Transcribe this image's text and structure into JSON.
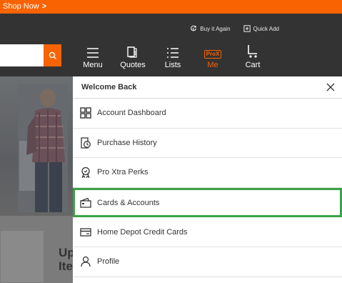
{
  "promo": {
    "text": "Shop Now",
    "chevron": ">"
  },
  "header": {
    "utility": [
      {
        "label": "Buy it Again",
        "icon": "refresh-dollar-icon"
      },
      {
        "label": "Quick Add",
        "icon": "quick-add-icon"
      }
    ],
    "nav": [
      {
        "label": "Menu",
        "icon": "hamburger-icon"
      },
      {
        "label": "Quotes",
        "icon": "quotes-icon"
      },
      {
        "label": "Lists",
        "icon": "lists-icon"
      },
      {
        "label": "Me",
        "icon": "prox-icon",
        "badge": "ProX"
      },
      {
        "label": "Cart",
        "icon": "cart-icon"
      }
    ]
  },
  "background": {
    "heading_line1": "Up",
    "heading_line2": "Ite"
  },
  "panel": {
    "title": "Welcome Back",
    "items": [
      {
        "label": "Account Dashboard",
        "icon": "dashboard-grid-icon"
      },
      {
        "label": "Purchase History",
        "icon": "purchase-history-icon"
      },
      {
        "label": "Pro Xtra Perks",
        "icon": "perks-badge-icon"
      },
      {
        "label": "Cards & Accounts",
        "icon": "wallet-icon"
      },
      {
        "label": "Home Depot Credit Cards",
        "icon": "credit-card-icon"
      },
      {
        "label": "Profile",
        "icon": "person-icon"
      }
    ]
  },
  "colors": {
    "brand_orange": "#f96302",
    "header_dark": "#333333",
    "highlight_green": "#3aa148"
  }
}
